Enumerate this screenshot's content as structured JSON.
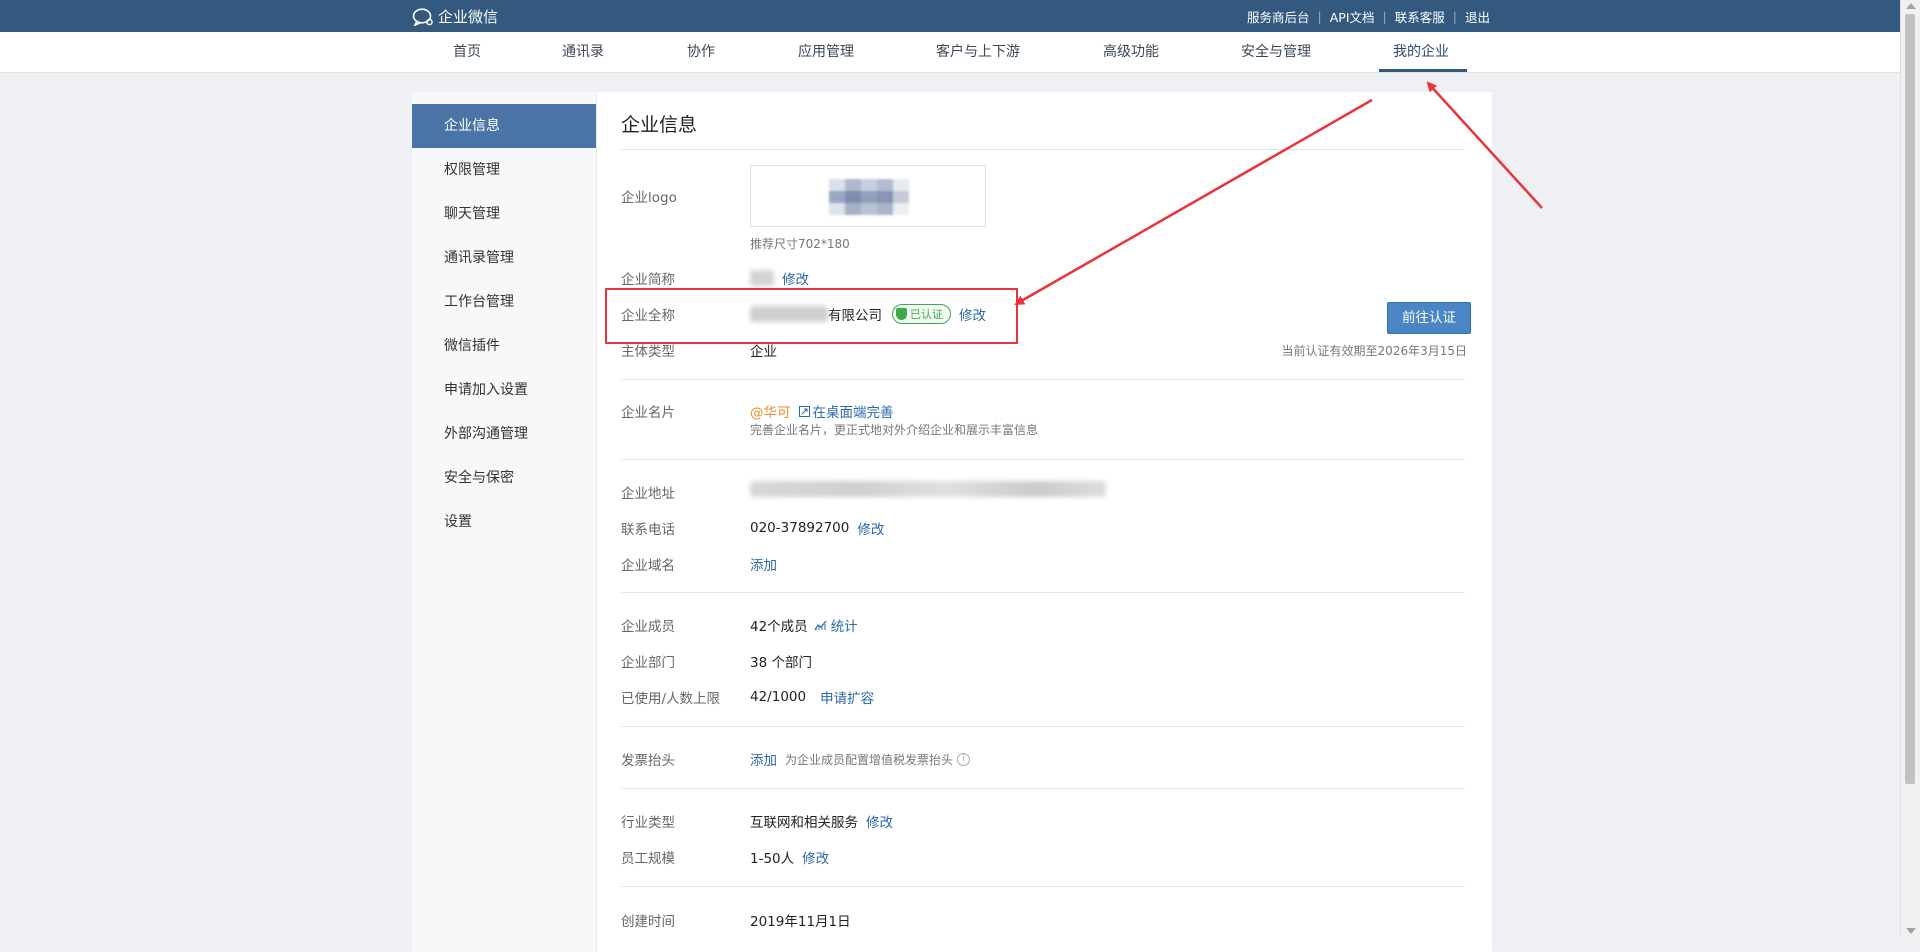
{
  "topbar": {
    "brand": "企业微信",
    "links": [
      "服务商后台",
      "API文档",
      "联系客服",
      "退出"
    ]
  },
  "nav": {
    "items": [
      "首页",
      "通讯录",
      "协作",
      "应用管理",
      "客户与上下游",
      "高级功能",
      "安全与管理",
      "我的企业"
    ],
    "active": "我的企业"
  },
  "sidebar": {
    "items": [
      "企业信息",
      "权限管理",
      "聊天管理",
      "通讯录管理",
      "工作台管理",
      "微信插件",
      "申请加入设置",
      "外部沟通管理",
      "安全与保密",
      "设置"
    ],
    "active": "企业信息"
  },
  "page_title": "企业信息",
  "logo": {
    "label": "企业logo",
    "hint": "推荐尺寸702*180"
  },
  "short_name": {
    "label": "企业简称",
    "edit": "修改"
  },
  "full_name": {
    "label": "企业全称",
    "value_suffix": "有限公司",
    "verified_badge": "已认证",
    "edit": "修改"
  },
  "verify_button": "前往认证",
  "entity_type": {
    "label": "主体类型",
    "value": "企业"
  },
  "validity": "当前认证有效期至2026年3月15日",
  "card": {
    "label": "企业名片",
    "handle": "@华可",
    "complete_link": "在桌面端完善",
    "desc": "完善企业名片，更正式地对外介绍企业和展示丰富信息"
  },
  "address": {
    "label": "企业地址"
  },
  "phone": {
    "label": "联系电话",
    "value": "020-37892700",
    "edit": "修改"
  },
  "domain": {
    "label": "企业域名",
    "add": "添加"
  },
  "members": {
    "label": "企业成员",
    "value": "42个成员",
    "stats": "统计"
  },
  "departments": {
    "label": "企业部门",
    "value": "38 个部门"
  },
  "limit": {
    "label": "已使用/人数上限",
    "value": "42/1000",
    "expand": "申请扩容"
  },
  "invoice": {
    "label": "发票抬头",
    "add": "添加",
    "desc": "为企业成员配置增值税发票抬头"
  },
  "industry": {
    "label": "行业类型",
    "value": "互联网和相关服务",
    "edit": "修改"
  },
  "staff_size": {
    "label": "员工规模",
    "value": "1-50人",
    "edit": "修改"
  },
  "created": {
    "label": "创建时间",
    "value": "2019年11月1日"
  },
  "colors": {
    "topbar": "#33597f",
    "accent": "#4a73a6",
    "annotation": "#e8343a",
    "verified": "#3daa4a"
  }
}
